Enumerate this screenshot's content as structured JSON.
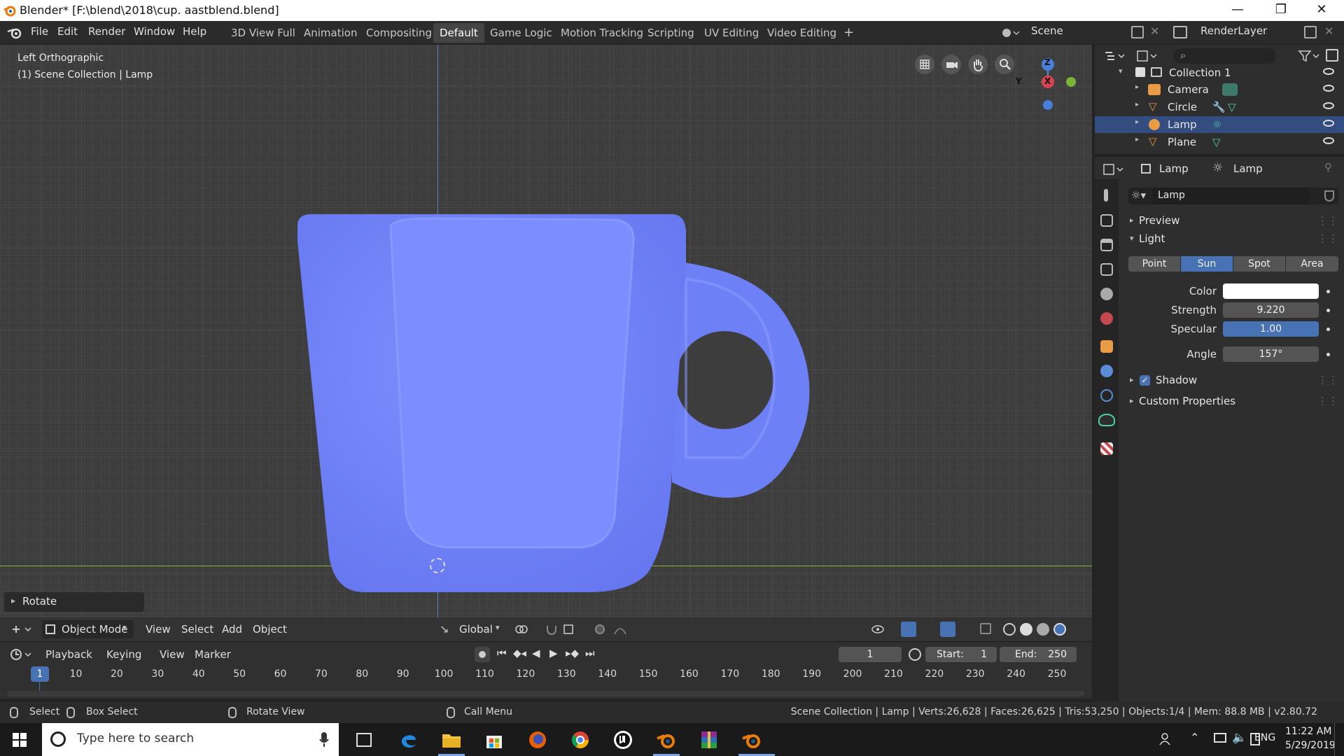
{
  "window": {
    "title": "Blender* [F:\\blend\\2018\\cup. aastblend.blend]",
    "minimize": "—",
    "maximize": "❐",
    "close": "✕"
  },
  "menubar": {
    "items": [
      "File",
      "Edit",
      "Render",
      "Window",
      "Help"
    ]
  },
  "workspaces": {
    "tabs": [
      "3D View Full",
      "Animation",
      "Compositing",
      "Default",
      "Game Logic",
      "Motion Tracking",
      "Scripting",
      "UV Editing",
      "Video Editing"
    ],
    "active": "Default",
    "add": "+"
  },
  "scene": {
    "label": "Scene",
    "render_layer": "RenderLayer"
  },
  "viewport": {
    "view_name": "Left Orthographic",
    "collection_info": "(1) Scene Collection | Lamp",
    "operator_panel": "Rotate",
    "axes": {
      "z": "Z",
      "y": "Y",
      "x": "X"
    },
    "mug_color": "#7b8cff"
  },
  "viewport_header": {
    "mode": "Object Mode",
    "menus": [
      "View",
      "Select",
      "Add",
      "Object"
    ],
    "orientation": "Global"
  },
  "outliner": {
    "collection": "Collection 1",
    "items": [
      {
        "name": "Camera",
        "selected": false
      },
      {
        "name": "Circle",
        "selected": false
      },
      {
        "name": "Lamp",
        "selected": true
      },
      {
        "name": "Plane",
        "selected": false
      }
    ]
  },
  "properties": {
    "breadcrumb_object": "Lamp",
    "breadcrumb_data": "Lamp",
    "datablock": "Lamp",
    "panels": {
      "preview": "Preview",
      "light": "Light",
      "shadow": "Shadow",
      "custom": "Custom Properties"
    },
    "light_types": [
      "Point",
      "Sun",
      "Spot",
      "Area"
    ],
    "light_type_active": "Sun",
    "color_label": "Color",
    "color_value": "#ffffff",
    "strength_label": "Strength",
    "strength": "9.220",
    "specular_label": "Specular",
    "specular": "1.00",
    "angle_label": "Angle",
    "angle": "157°"
  },
  "timeline": {
    "menus": [
      "Playback",
      "Keying",
      "View",
      "Marker"
    ],
    "current_frame": "1",
    "start_label": "Start:",
    "start": "1",
    "end_label": "End:",
    "end": "250",
    "ticks": [
      "1",
      "10",
      "20",
      "30",
      "40",
      "50",
      "60",
      "70",
      "80",
      "90",
      "100",
      "110",
      "120",
      "130",
      "140",
      "150",
      "160",
      "170",
      "180",
      "190",
      "200",
      "210",
      "220",
      "230",
      "240",
      "250"
    ]
  },
  "statusbar": {
    "select": "Select",
    "box_select": "Box Select",
    "rotate_view": "Rotate View",
    "call_menu": "Call Menu",
    "stats": "Scene Collection | Lamp | Verts:26,628 | Faces:26,625 | Tris:53,250 | Objects:1/4 | Mem: 88.8 MB | v2.80.72"
  },
  "taskbar": {
    "search_placeholder": "Type here to search",
    "lang": "ENG",
    "time": "11:22 AM",
    "date": "5/29/2019"
  }
}
